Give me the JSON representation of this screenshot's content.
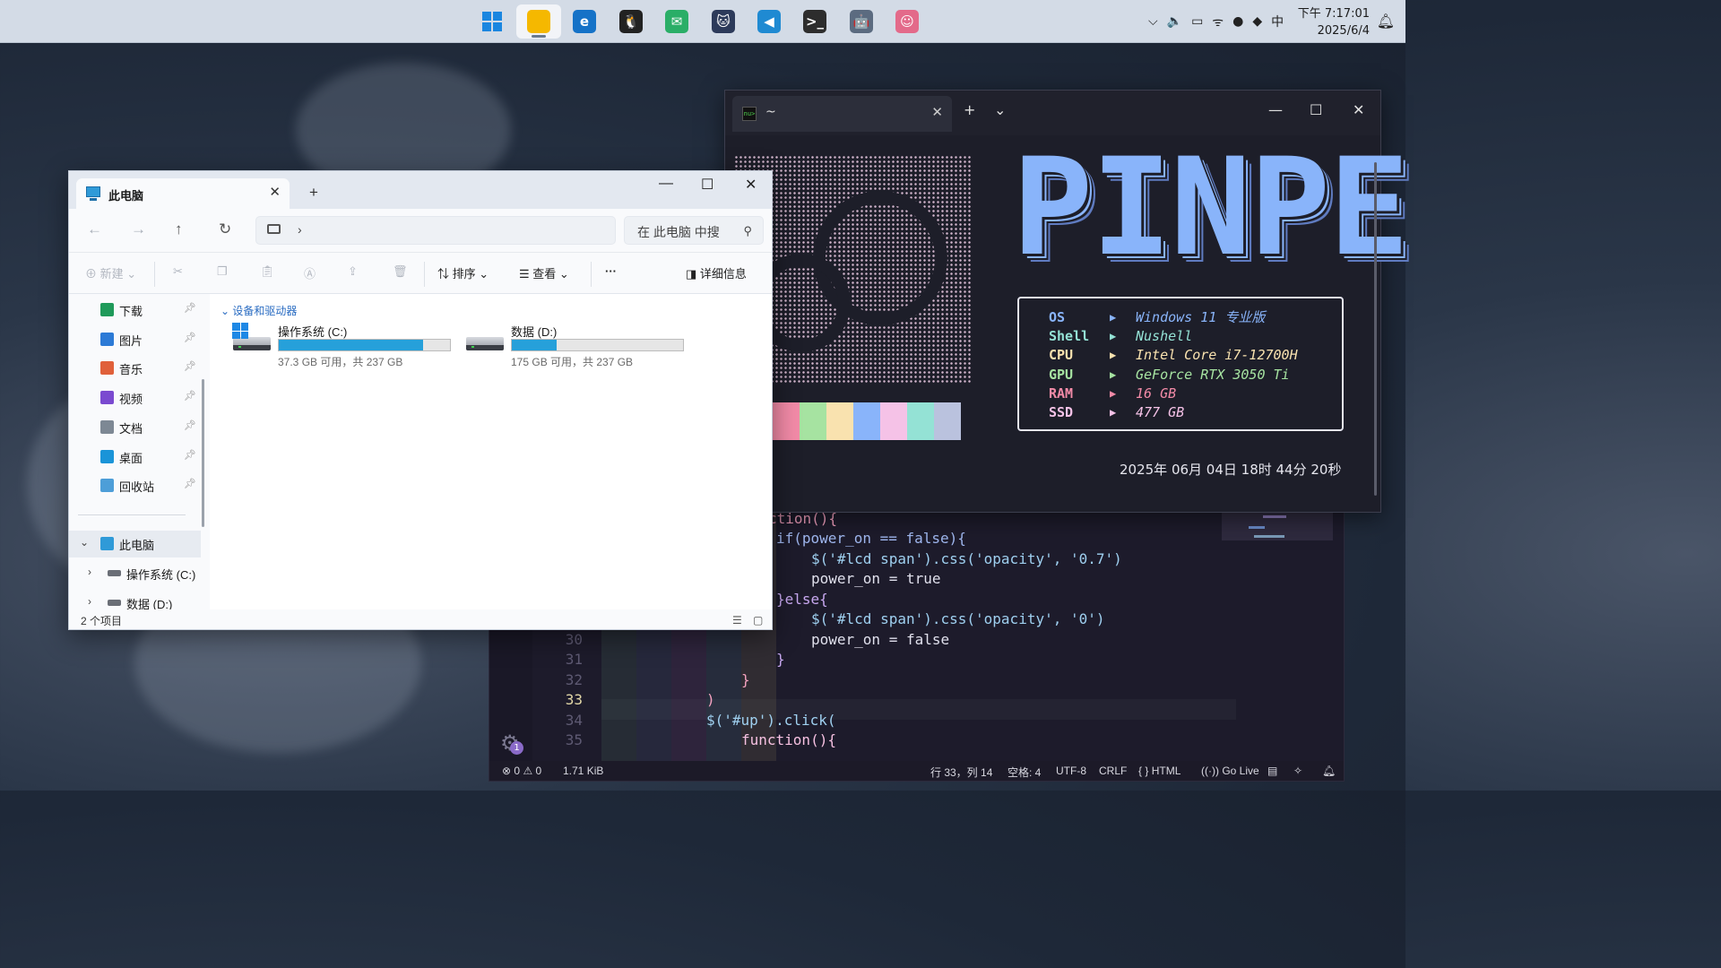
{
  "taskbar": {
    "apps": [
      {
        "name": "start-menu-icon",
        "glyph": "",
        "color": "#0a78d4"
      },
      {
        "name": "file-explorer-icon",
        "glyph": "",
        "color": "#f5b800"
      },
      {
        "name": "edge-icon",
        "glyph": "e",
        "color": "#1572c7"
      },
      {
        "name": "qq-icon",
        "glyph": "🐧",
        "color": "#222222"
      },
      {
        "name": "wechat-icon",
        "glyph": "✉",
        "color": "#2aae67"
      },
      {
        "name": "cat-app-icon",
        "glyph": "🐱",
        "color": "#2c3a5a"
      },
      {
        "name": "vscode-icon",
        "glyph": "◀",
        "color": "#1f8ad2"
      },
      {
        "name": "terminal-icon",
        "glyph": ">_",
        "color": "#2d2d2d"
      },
      {
        "name": "bot-app-icon",
        "glyph": "🤖",
        "color": "#5b6b80"
      },
      {
        "name": "anime-app-icon",
        "glyph": "☺",
        "color": "#e36a8a"
      }
    ],
    "tray": {
      "input_method": "中",
      "clock_time": "下午 7:17:01",
      "clock_date": "2025/6/4"
    }
  },
  "terminal": {
    "tab_title": "~",
    "tab_icon_text": "nu>",
    "logo_text": "PINPE",
    "sysinfo": [
      {
        "key": "OS",
        "value": "Windows 11 专业版",
        "key_color": "#89b4fa",
        "value_color": "#89b4fa"
      },
      {
        "key": "Shell",
        "value": "Nushell",
        "key_color": "#94e2d5",
        "value_color": "#94e2d5"
      },
      {
        "key": "CPU",
        "value": "Intel Core i7-12700H",
        "key_color": "#f9e2af",
        "value_color": "#f9e2af"
      },
      {
        "key": "GPU",
        "value": "GeForce RTX 3050 Ti",
        "key_color": "#a6e3a1",
        "value_color": "#a6e3a1"
      },
      {
        "key": "RAM",
        "value": "16 GB",
        "key_color": "#f38ba8",
        "value_color": "#f38ba8"
      },
      {
        "key": "SSD",
        "value": "477 GB",
        "key_color": "#f5c2e7",
        "value_color": "#f5c2e7"
      }
    ],
    "arrow": "▶",
    "datetime": "2025年 06月 04日  18时 44分 20秒",
    "palette": [
      "#f38ba8",
      "#a6e3a1",
      "#f9e2af",
      "#89b4fa",
      "#f5c2e7",
      "#94e2d5",
      "#bac2de"
    ]
  },
  "editor": {
    "lines": [
      {
        "num": "",
        "text": "ction(){",
        "indent": 0
      },
      {
        "num": "",
        "text": "if(power_on == false){",
        "indent": 0
      },
      {
        "num": "",
        "text": "$('#lcd span').css('opacity', '0.7')",
        "indent": 1
      },
      {
        "num": "",
        "text": "power_on = true",
        "indent": 1
      },
      {
        "num": "",
        "text": "}else{",
        "indent": 0
      },
      {
        "num": "",
        "text": "$('#lcd span').css('opacity', '0')",
        "indent": 1
      },
      {
        "num": "30",
        "text": "power_on = false",
        "indent": 1
      },
      {
        "num": "31",
        "text": "}",
        "indent": 0
      },
      {
        "num": "32",
        "text": "}",
        "indent": 0
      },
      {
        "num": "33",
        "text": ")",
        "indent": 0
      },
      {
        "num": "34",
        "text": "$('#up').click(",
        "indent": 0
      },
      {
        "num": "35",
        "text": "function(){",
        "indent": 0
      }
    ],
    "gear_badge": "1",
    "status": {
      "errors": "0",
      "warnings": "0",
      "size": "1.71 KiB",
      "position": "行 33，列 14",
      "spaces": "空格: 4",
      "encoding": "UTF-8",
      "eol": "CRLF",
      "language": "HTML",
      "golive": "Go Live"
    }
  },
  "explorer": {
    "tab_title": "此电脑",
    "search_placeholder": "在 此电脑 中搜",
    "toolbar": {
      "new": "新建",
      "sort": "排序",
      "view": "查看",
      "more": "···",
      "details": "详细信息"
    },
    "sidebar": [
      {
        "label": "下载",
        "icon": "download-icon",
        "color": "#1f9a5a",
        "pinned": true
      },
      {
        "label": "图片",
        "icon": "pictures-icon",
        "color": "#2c7ad6",
        "pinned": true
      },
      {
        "label": "音乐",
        "icon": "music-icon",
        "color": "#e0603a",
        "pinned": true
      },
      {
        "label": "视频",
        "icon": "video-icon",
        "color": "#7a4ad0",
        "pinned": true
      },
      {
        "label": "文档",
        "icon": "documents-icon",
        "color": "#7d8894",
        "pinned": true
      },
      {
        "label": "桌面",
        "icon": "desktop-icon",
        "color": "#1a94d8",
        "pinned": true
      },
      {
        "label": "回收站",
        "icon": "recycle-bin-icon",
        "color": "#4d9ed8",
        "pinned": true
      }
    ],
    "tree": [
      {
        "label": "此电脑",
        "expanded": true
      },
      {
        "label": "操作系统 (C:)"
      },
      {
        "label": "数据 (D:)"
      }
    ],
    "section_title": "设备和驱动器",
    "drives": [
      {
        "name": "操作系统 (C:)",
        "free_text": "37.3 GB 可用，共 237 GB",
        "used_fraction": 0.843
      },
      {
        "name": "数据 (D:)",
        "free_text": "175 GB 可用，共 237 GB",
        "used_fraction": 0.262
      }
    ],
    "item_count": "2 个项目"
  }
}
